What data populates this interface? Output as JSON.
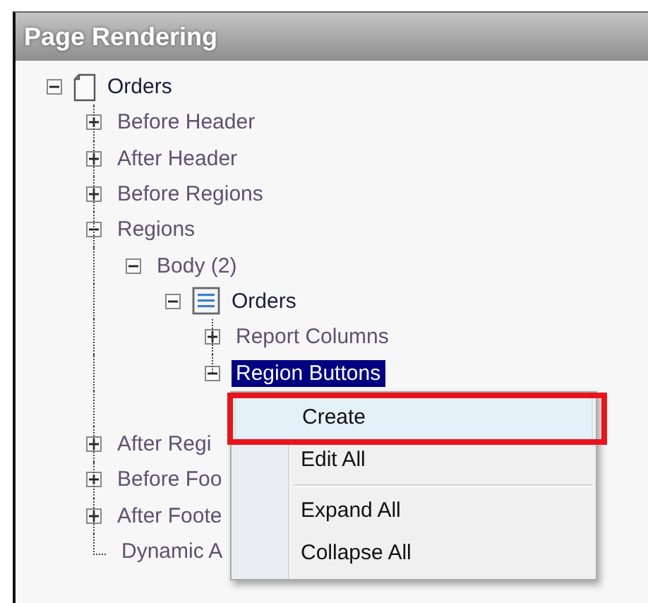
{
  "panel": {
    "title": "Page Rendering"
  },
  "tree": [
    {
      "label": "Orders",
      "kind": "page",
      "expanded": true,
      "selected": false,
      "children": [
        {
          "label": "Before Header",
          "expanded": false,
          "selected": false
        },
        {
          "label": "After Header",
          "expanded": false,
          "selected": false
        },
        {
          "label": "Before Regions",
          "expanded": false,
          "selected": false
        },
        {
          "label": "Regions",
          "expanded": true,
          "selected": false,
          "children": [
            {
              "label": "Body (2)",
              "expanded": true,
              "selected": false,
              "children": [
                {
                  "label": "Orders",
                  "kind": "report",
                  "expanded": true,
                  "selected": false,
                  "children": [
                    {
                      "label": "Report Columns",
                      "expanded": false,
                      "selected": false
                    },
                    {
                      "label": "Region Buttons",
                      "expanded": true,
                      "selected": true
                    }
                  ]
                }
              ]
            }
          ]
        },
        {
          "label": "After Regi",
          "expanded": false,
          "selected": false
        },
        {
          "label": "Before Foo",
          "expanded": false,
          "selected": false
        },
        {
          "label": "After Foote",
          "expanded": false,
          "selected": false
        },
        {
          "label": "Dynamic A",
          "kind": "leaf",
          "selected": false
        }
      ]
    }
  ],
  "context_menu": {
    "items": [
      {
        "kind": "item",
        "label": "Create",
        "selected": true
      },
      {
        "kind": "item",
        "label": "Edit All",
        "selected": false
      },
      {
        "kind": "separator"
      },
      {
        "kind": "item",
        "label": "Expand All",
        "selected": false
      },
      {
        "kind": "item",
        "label": "Collapse All",
        "selected": false
      }
    ]
  }
}
